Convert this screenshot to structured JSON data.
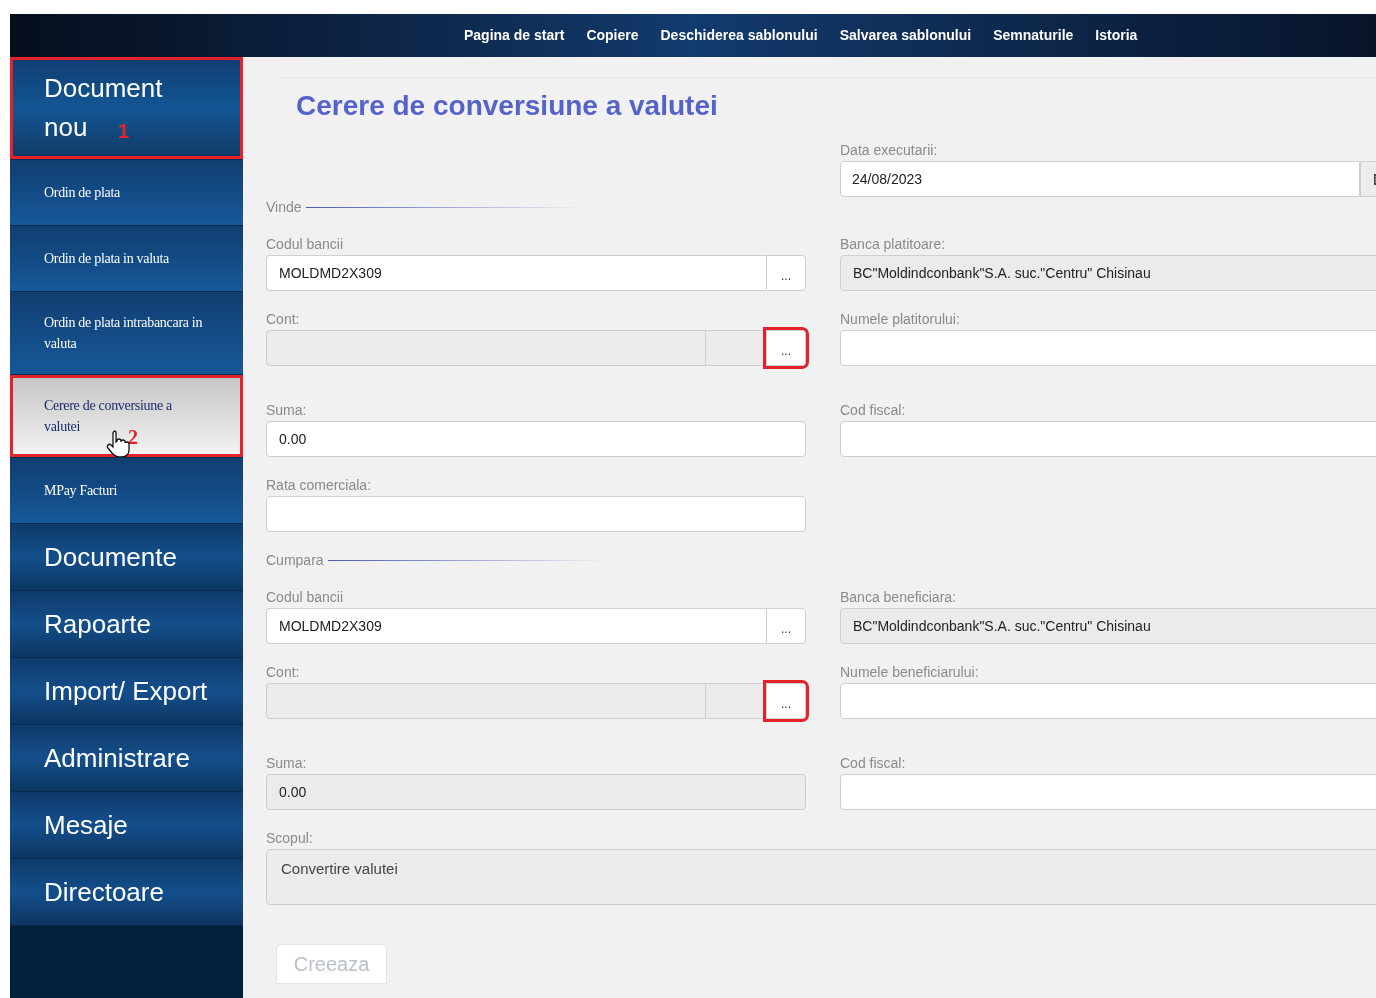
{
  "top_menu": [
    "Pagina de start",
    "Copiere",
    "Deschiderea sablonului",
    "Salvarea sablonului",
    "Semnaturile",
    "Istoria"
  ],
  "sidebar": {
    "items": [
      {
        "label": "Document nou",
        "kind": "header",
        "selected": false,
        "annotation": "1"
      },
      {
        "label": "Ordin de plata",
        "kind": "sub",
        "selected": false
      },
      {
        "label": "Ordin de plata in valuta",
        "kind": "sub",
        "selected": false
      },
      {
        "label": "Ordin de plata intrabancara in valuta",
        "kind": "sub",
        "selected": false
      },
      {
        "label": "Cerere de conversiune a valutei",
        "kind": "sub",
        "selected": true,
        "annotation": "2",
        "pointer": true
      },
      {
        "label": "MPay Facturi",
        "kind": "sub",
        "selected": false
      },
      {
        "label": "Documente",
        "kind": "section",
        "selected": false
      },
      {
        "label": "Rapoarte",
        "kind": "section",
        "selected": false
      },
      {
        "label": "Import/ Export",
        "kind": "section",
        "selected": false
      },
      {
        "label": "Administrare",
        "kind": "section",
        "selected": false
      },
      {
        "label": "Mesaje",
        "kind": "section",
        "selected": false
      },
      {
        "label": "Directoare",
        "kind": "section",
        "selected": false
      }
    ]
  },
  "title": "Cerere de conversiune a valutei",
  "date": {
    "label": "Data executarii:",
    "value": "24/08/2023"
  },
  "sections": [
    {
      "legend": "Vinde",
      "rows": [
        {
          "left": {
            "kind": "lookup",
            "label": "Codul bancii",
            "value": "MOLDMD2X309",
            "readonly": false,
            "button": "...",
            "annotated": false
          },
          "right": {
            "kind": "text",
            "label": "Banca platitoare:",
            "value": "BC\"Moldindconbank\"S.A. suc.\"Centru\" Chisinau",
            "readonly": true
          }
        },
        {
          "left": {
            "kind": "account",
            "label": "Cont:",
            "readonly": true,
            "button": "...",
            "annotated": true
          },
          "right": {
            "kind": "text",
            "label": "Numele platitorului:",
            "readonly": false
          }
        },
        {
          "left": {
            "kind": "text",
            "label": "Suma:",
            "value": "0.00",
            "readonly": false
          },
          "right": {
            "kind": "text",
            "label": "Cod fiscal:",
            "readonly": false
          }
        },
        {
          "left": {
            "kind": "text",
            "label": "Rata comerciala:",
            "readonly": false
          }
        }
      ]
    },
    {
      "legend": "Cumpara",
      "rows": [
        {
          "left": {
            "kind": "lookup",
            "label": "Codul bancii",
            "value": "MOLDMD2X309",
            "readonly": false,
            "button": "...",
            "annotated": false
          },
          "right": {
            "kind": "text",
            "label": "Banca beneficiara:",
            "value": "BC\"Moldindconbank\"S.A. suc.\"Centru\" Chisinau",
            "readonly": true
          }
        },
        {
          "left": {
            "kind": "account",
            "label": "Cont:",
            "readonly": true,
            "button": "...",
            "annotated": true
          },
          "right": {
            "kind": "text",
            "label": "Numele beneficiarului:",
            "readonly": false
          }
        },
        {
          "left": {
            "kind": "text",
            "label": "Suma:",
            "value": "0.00",
            "readonly": true
          },
          "right": {
            "kind": "text",
            "label": "Cod fiscal:",
            "readonly": false
          }
        }
      ]
    }
  ],
  "purpose": {
    "label": "Scopul:",
    "value": "Convertire valutei",
    "readonly": true
  },
  "submit": {
    "label": "Creeaza",
    "disabled": true
  }
}
